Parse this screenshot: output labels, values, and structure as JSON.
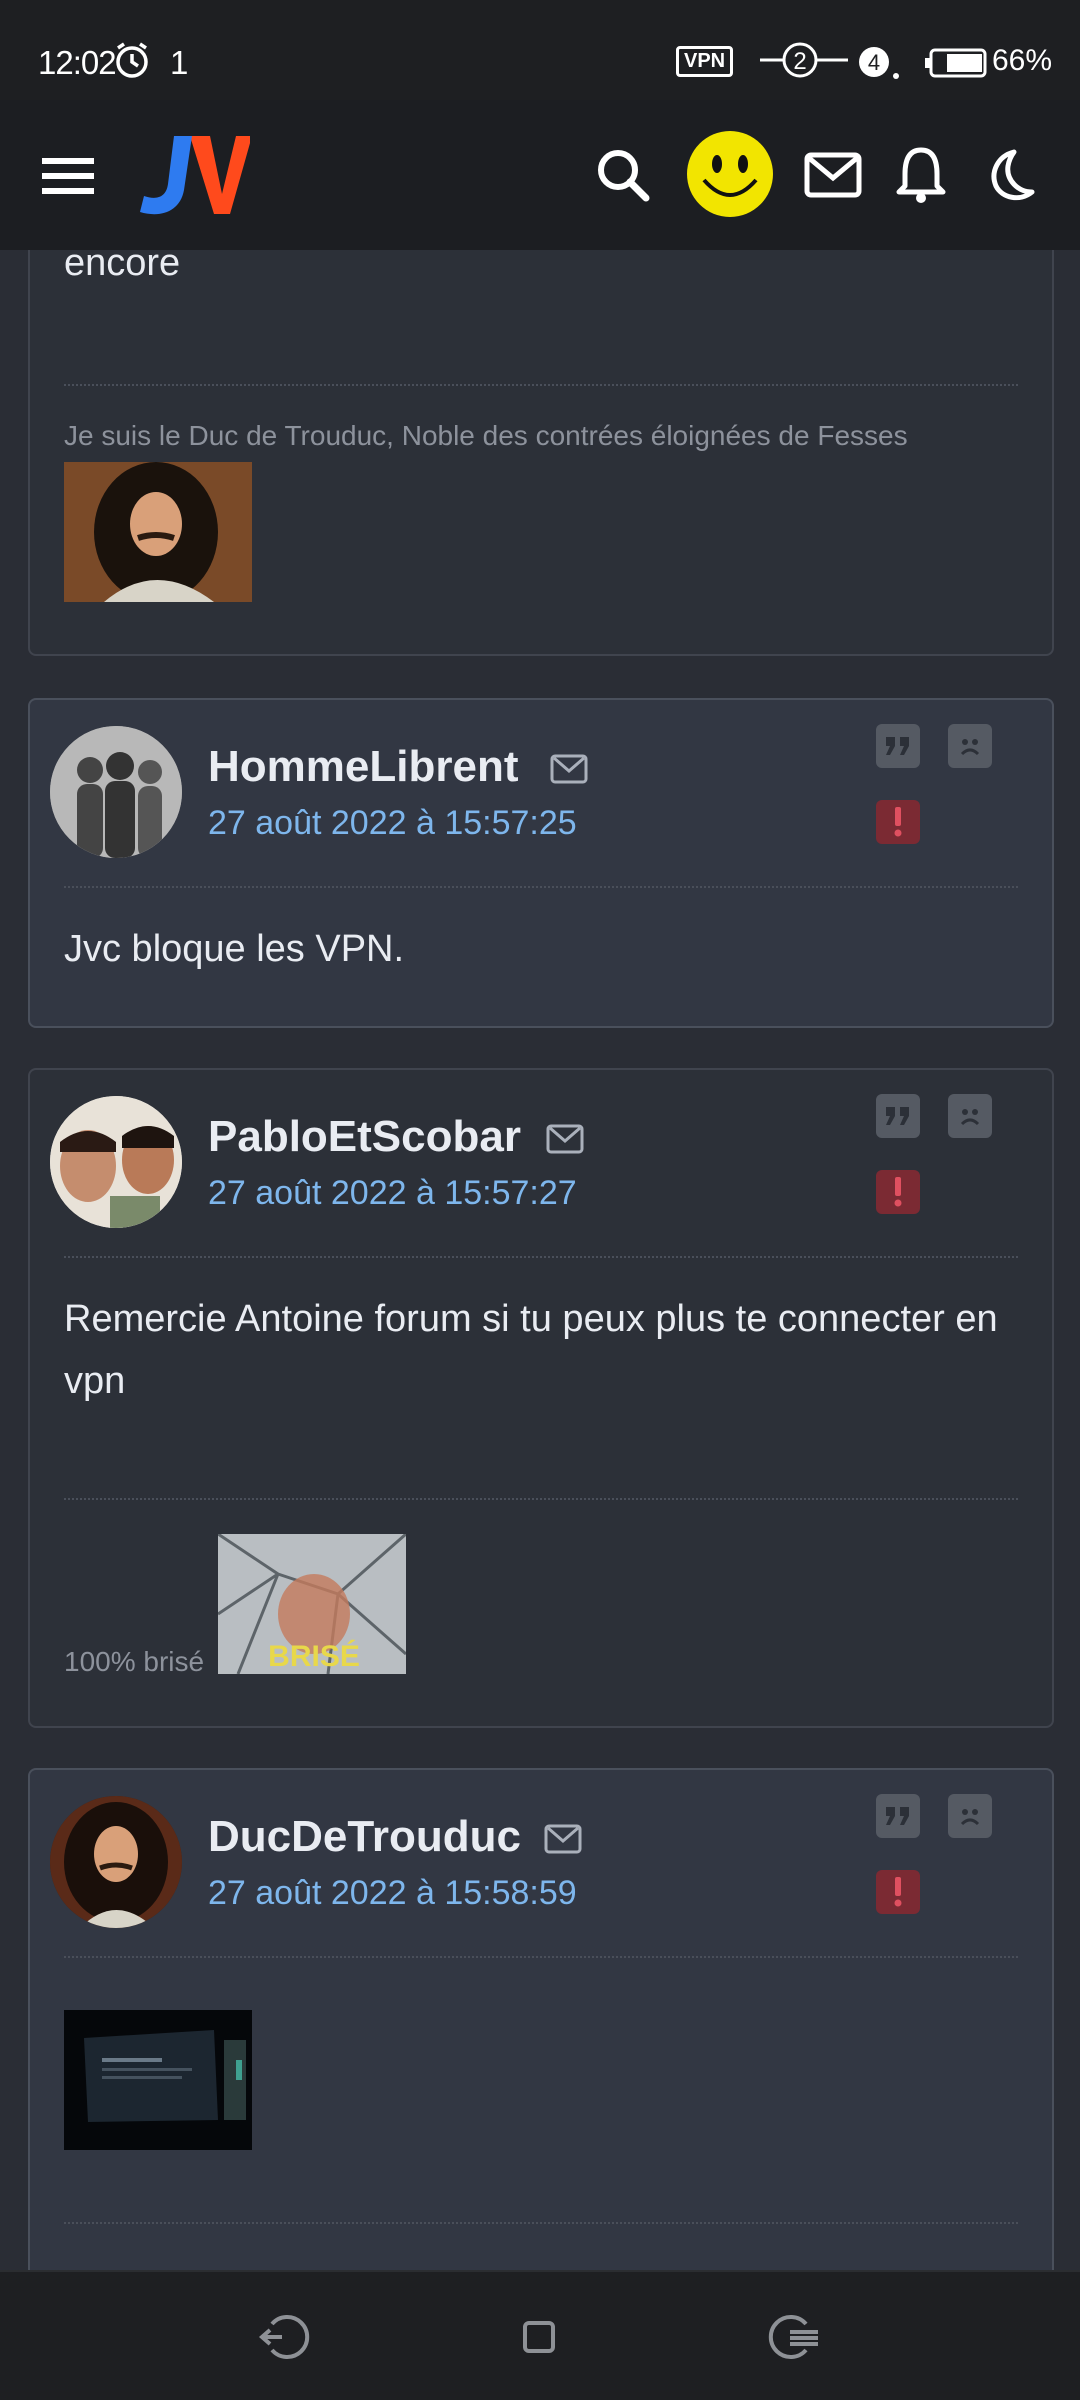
{
  "status": {
    "time": "12:02",
    "notif_count": "1",
    "vpn": "VPN",
    "sim_slot": "2",
    "signal": "4",
    "battery": "66%"
  },
  "nav": {
    "logo": "JV",
    "icons": [
      "menu-icon",
      "search-icon",
      "smiley-avatar",
      "mail-icon",
      "bell-icon",
      "moon-icon"
    ]
  },
  "posts": {
    "prev": {
      "text_tail": "encore",
      "signature": "Je suis le Duc de Trouduc, Noble des contrées éloignées de Fesses"
    },
    "p1": {
      "username": "HommeLibrent",
      "date": "27 août 2022 à 15:57:25",
      "text": "Jvc bloque les VPN."
    },
    "p2": {
      "username": "PabloEtScobar",
      "date": "27 août 2022 à 15:57:27",
      "text": "Remercie Antoine forum si tu peux plus te connecter en vpn",
      "signature": "100% brisé",
      "sig_image_text": "BRISÉ"
    },
    "p3": {
      "username": "DucDeTrouduc",
      "date": "27 août 2022 à 15:58:59"
    }
  },
  "colors": {
    "accent_date": "#7eb6ec",
    "card_bg": "#2c3038",
    "card_alt_bg": "#323743",
    "alert": "#7b2a33"
  }
}
